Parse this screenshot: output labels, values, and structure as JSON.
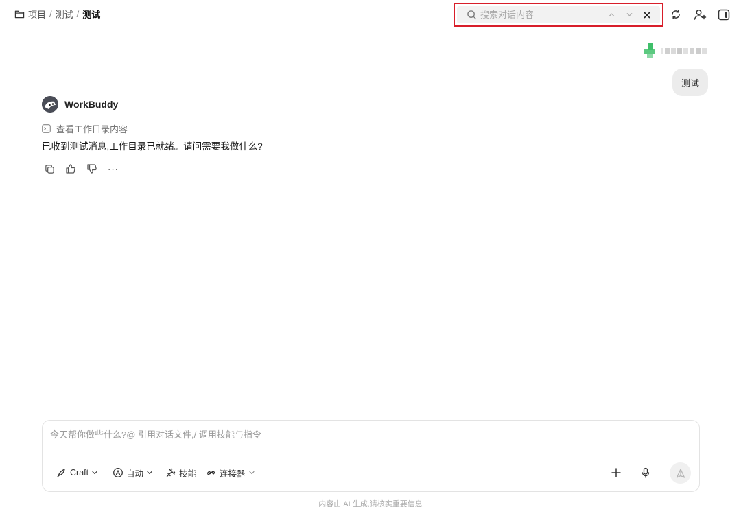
{
  "header": {
    "breadcrumb": {
      "root": "项目",
      "project": "测试",
      "current": "测试",
      "separator": "/"
    },
    "search": {
      "placeholder": "搜索对话内容",
      "value": ""
    },
    "icons": [
      "folder-icon",
      "search-icon",
      "chevron-up-icon",
      "chevron-down-icon",
      "close-icon",
      "sync-icon",
      "add-user-icon",
      "sidebar-toggle-icon"
    ]
  },
  "conversation": {
    "user_message": {
      "text": "测试"
    },
    "assistant": {
      "name": "WorkBuddy",
      "tool_step": "查看工作目录内容",
      "reply": "已收到测试消息,工作目录已就绪。请问需要我做什么?",
      "actions": [
        "copy-icon",
        "thumbs-up-icon",
        "thumbs-down-icon",
        "more-icon"
      ],
      "more_label": "···"
    }
  },
  "composer": {
    "placeholder": "今天帮你做些什么?@ 引用对话文件,/ 调用技能与指令",
    "mode_label": "Craft",
    "model_label": "自动",
    "skills_label": "技能",
    "connectors_label": "连接器"
  },
  "footer": {
    "note": "内容由 AI 生成,请核实重要信息"
  },
  "colors": {
    "highlight_border": "#d81e2a",
    "user_bubble": "#ececec",
    "avatar_green": "#3fbf6a"
  }
}
